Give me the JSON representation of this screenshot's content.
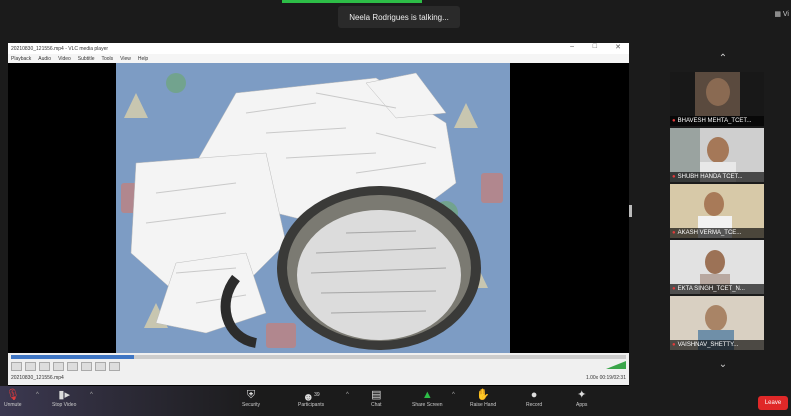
{
  "meeting": {
    "speaking_indicator": "Neela Rodrigues is talking...",
    "view_label": "Vi"
  },
  "vlc": {
    "title": "20210830_121556.mp4 - VLC media player",
    "menu": [
      "Playback",
      "Audio",
      "Video",
      "Subtitle",
      "Tools",
      "View",
      "Help"
    ],
    "status_left": "20210830_121556.mp4",
    "status_right": "1.00x   00:19/02:31",
    "progress_fraction": 0.2
  },
  "participants": [
    {
      "name": "BHAVESH MEHTA_TCET..."
    },
    {
      "name": "SHUBH HANDA TCET..."
    },
    {
      "name": "AKASH VERMA_TCE..."
    },
    {
      "name": "EKTA SINGH_TCET_N..."
    },
    {
      "name": "VAISHNAV_SHETTY..."
    }
  ],
  "toolbar": {
    "items": [
      {
        "label": "Unmute",
        "icon": "microphone-muted-icon"
      },
      {
        "label": "Stop Video",
        "icon": "video-camera-icon"
      },
      {
        "label": "Security",
        "icon": "shield-icon"
      },
      {
        "label": "Participants",
        "icon": "participants-icon",
        "badge": "39"
      },
      {
        "label": "Chat",
        "icon": "chat-icon"
      },
      {
        "label": "Share Screen",
        "icon": "share-screen-icon"
      },
      {
        "label": "Raise Hand",
        "icon": "raise-hand-icon"
      },
      {
        "label": "Record",
        "icon": "record-icon"
      },
      {
        "label": "Apps",
        "icon": "apps-icon"
      }
    ],
    "leave_label": "Leave"
  },
  "colors": {
    "accent_green": "#2dbd47",
    "leave_red": "#e02828",
    "background": "#1b1b1b"
  }
}
